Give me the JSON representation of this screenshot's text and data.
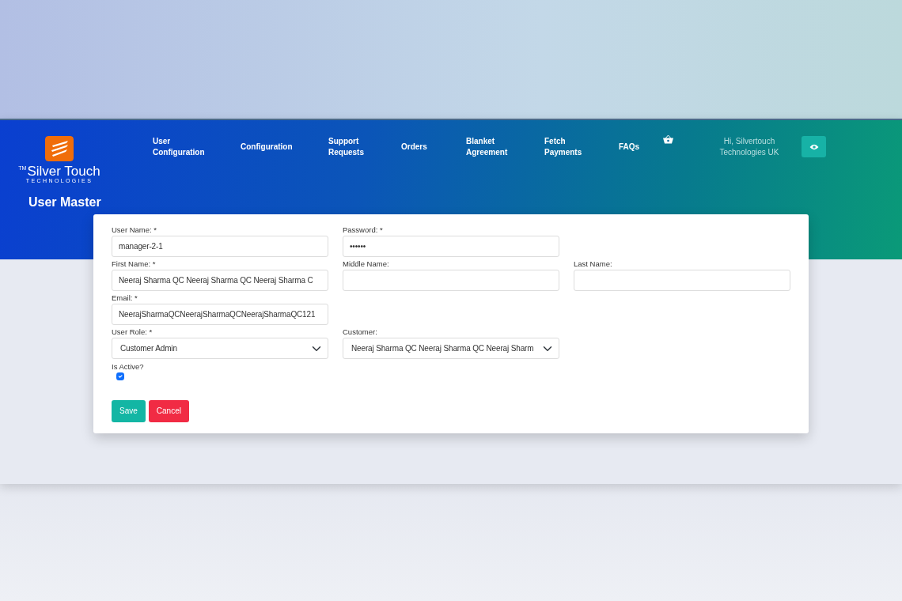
{
  "logo": {
    "mark": "TM",
    "name": "Silver Touch",
    "tagline": "TECHNOLOGIES"
  },
  "nav": [
    {
      "label": "User Configuration"
    },
    {
      "label": "Configuration"
    },
    {
      "label": "Support Requests"
    },
    {
      "label": "Orders"
    },
    {
      "label": "Blanket Agreement"
    },
    {
      "label": "Fetch Payments"
    },
    {
      "label": "FAQs"
    }
  ],
  "greeting": "Hi, Silvertouch Technologies UK",
  "page_title": "User Master",
  "form": {
    "rows": [
      [
        {
          "label": "User Name: *",
          "kind": "text",
          "value": "manager-2-1"
        },
        {
          "label": "Password: *",
          "kind": "text",
          "value": "••••••"
        }
      ],
      [
        {
          "label": "First Name: *",
          "kind": "text",
          "value": "Neeraj Sharma QC Neeraj Sharma QC Neeraj Sharma C"
        },
        {
          "label": "Middle Name:",
          "kind": "text"
        },
        {
          "label": "Last Name:",
          "kind": "text"
        }
      ],
      [
        {
          "label": "Email: *",
          "kind": "text",
          "value": "NeerajSharmaQCNeerajSharmaQCNeerajSharmaQC121"
        }
      ],
      [
        {
          "label": "User Role: *",
          "kind": "select",
          "value": "Customer Admin"
        },
        {
          "label": "Customer:",
          "kind": "select",
          "value": "Neeraj Sharma QC Neeraj Sharma QC Neeraj Sharm"
        }
      ]
    ],
    "is_active": {
      "label": "Is Active?",
      "checked": true
    },
    "buttons": [
      {
        "label": "Save",
        "kind": "primary"
      },
      {
        "label": "Cancel",
        "kind": "danger"
      }
    ]
  }
}
